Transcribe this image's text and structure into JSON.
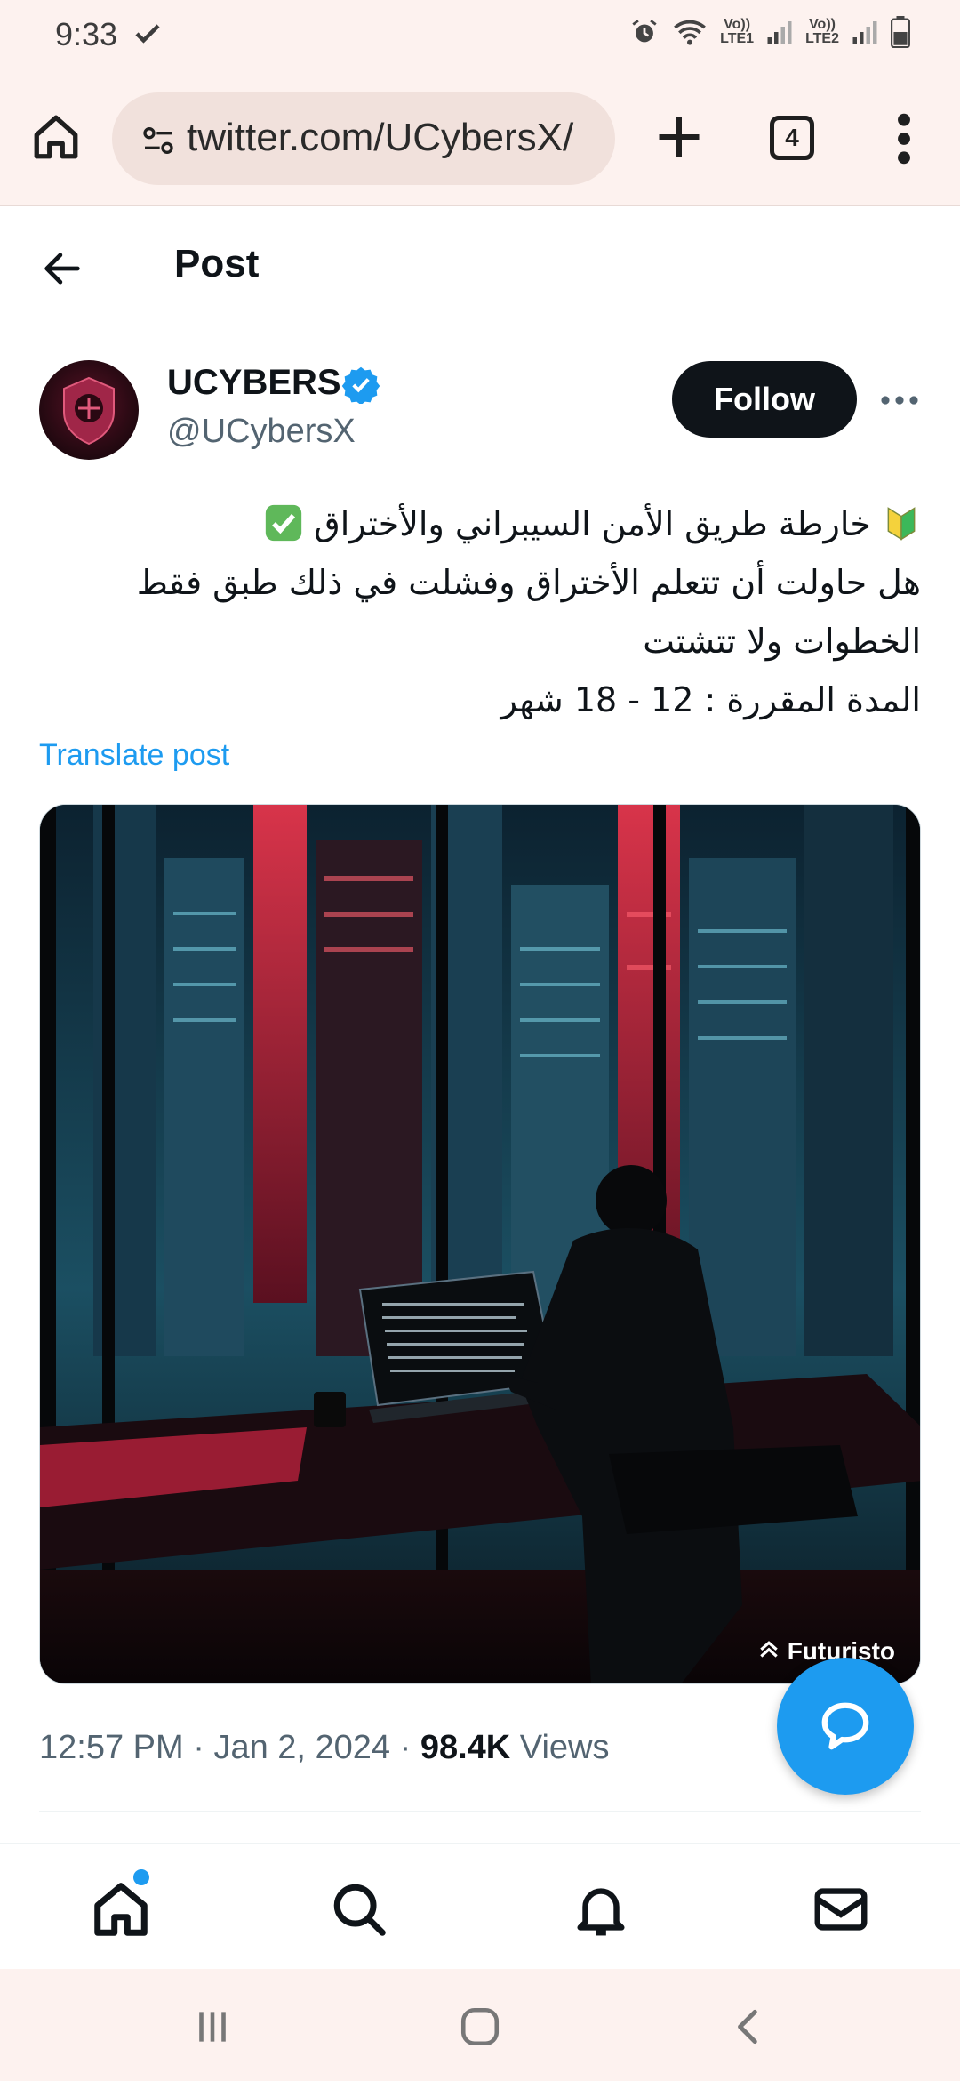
{
  "status_bar": {
    "time": "9:33",
    "net1": [
      "Vo))",
      "LTE1"
    ],
    "net2": [
      "Vo))",
      "LTE2"
    ]
  },
  "browser": {
    "url": "twitter.com/UCybersX/",
    "tab_count": "4"
  },
  "header": {
    "title": "Post"
  },
  "author": {
    "name": "UCYBERS",
    "handle": "@UCybersX",
    "follow_label": "Follow"
  },
  "tweet": {
    "lines": [
      "خارطة طريق الأمن السيبراني والأختراق",
      "هل حاولت أن تتعلم الأختراق وفشلت في ذلك  طبق فقط",
      "الخطوات ولا تتشتت",
      "المدة المقررة : 12 - 18 شهر"
    ],
    "translate_label": "Translate post",
    "image_watermark": "Futuristo"
  },
  "meta": {
    "time": "12:57 PM",
    "date": "Jan 2, 2024",
    "views_count": "98.4K",
    "views_label": "Views",
    "sep": "·"
  },
  "icons": {
    "home": "home-icon",
    "search": "search-icon",
    "notifications": "bell-icon",
    "messages": "mail-icon",
    "compose": "chat-bubble-icon"
  },
  "colors": {
    "accent": "#1d9bf0",
    "text": "#0f1419",
    "muted": "#536471",
    "browser_bg": "#fdf2ef"
  }
}
